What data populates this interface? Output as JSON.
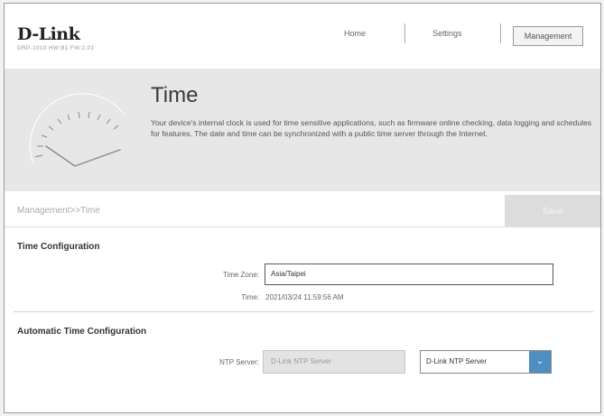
{
  "header": {
    "brand": "D-Link",
    "model": "DRP-1010 HW:B1 FW:2.01",
    "nav": {
      "home": "Home",
      "settings": "Settings",
      "management": "Management"
    }
  },
  "banner": {
    "title": "Time",
    "description": "Your device's internal clock is used for time sensitive applications, such as firmware online checking, data logging and schedules for features. The date and time can be synchronized with a public time server through the Internet."
  },
  "breadcrumb": "Management>>Time",
  "save_label": "Save",
  "time_config": {
    "title": "Time Configuration",
    "timezone_label": "Time Zone:",
    "timezone_value": "Asia/Taipei",
    "time_label": "Time:",
    "time_value": "2021/03/24 11:59:56 AM"
  },
  "auto_config": {
    "title": "Automatic Time Configuration",
    "ntp_label": "NTP Server:",
    "ntp_value": "D-Link NTP Server",
    "ntp_select_value": "D-Link NTP Server"
  },
  "colors": {
    "accent": "#4f8ec0",
    "banner": "#e7e7e7"
  },
  "icons": {
    "clock": "clock-face-icon",
    "dropdown": "chevron-down-icon"
  }
}
